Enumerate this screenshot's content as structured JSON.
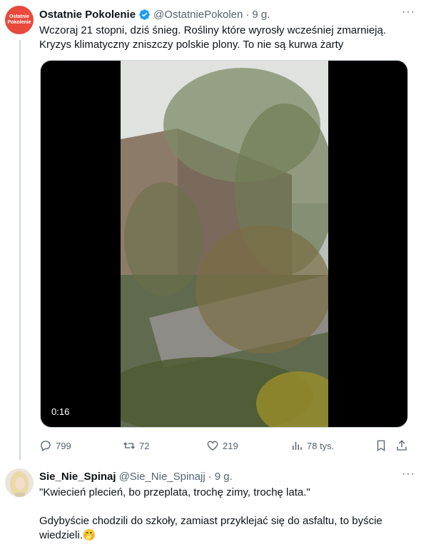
{
  "tweet": {
    "avatar_text_line1": "Ostatnie",
    "avatar_text_line2": "Pokolenie",
    "author_name": "Ostatnie Pokolenie",
    "handle": "@OstatniePokolen",
    "separator": "·",
    "time": "9 g.",
    "more_label": "···",
    "text_line1": "Wczoraj 21 stopni, dziś śnieg. Rośliny które wyrosły wcześniej zmarnieją.",
    "text_line2": "Kryzys klimatyczny zniszczy polskie plony. To nie są kurwa żarty",
    "video_duration": "0:16",
    "actions": {
      "replies": "799",
      "retweets": "72",
      "likes": "219",
      "views": "78 tys."
    }
  },
  "reply": {
    "author_name": "Sie_Nie_Spinaj",
    "handle": "@Sie_Nie_Spinajj",
    "separator": "·",
    "time": "9 g.",
    "more_label": "···",
    "line1": "\"Kwiecień plecień, bo przeplata, trochę zimy, trochę lata.\"",
    "line2": "Gdybyście chodzili do szkoły, zamiast przyklejać się do asfaltu, to byście",
    "line3": "wiedzieli.🤭"
  },
  "colors": {
    "accent": "#1d9bf0",
    "brand": "#e8493c",
    "muted": "#536471"
  }
}
